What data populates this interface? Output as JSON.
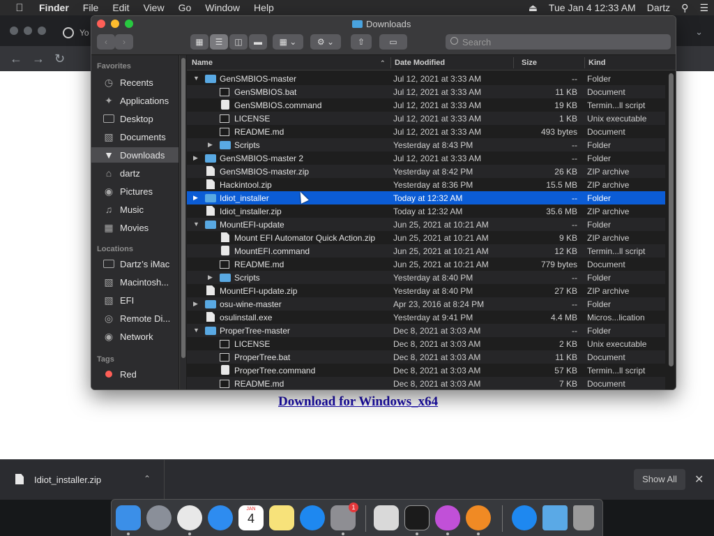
{
  "menubar": {
    "app": "Finder",
    "items": [
      "File",
      "Edit",
      "View",
      "Go",
      "Window",
      "Help"
    ],
    "datetime": "Tue Jan 4  12:33 AM",
    "user": "Dartz"
  },
  "chrome": {
    "tab_title": "Yo",
    "download_link": "Download for Windows_x64"
  },
  "download_shelf": {
    "file_name": "Idiot_installer.zip",
    "show_all": "Show All"
  },
  "finder": {
    "title": "Downloads",
    "search_placeholder": "Search",
    "sidebar": {
      "favorites_header": "Favorites",
      "favorites": [
        {
          "label": "Recents",
          "icon": "clock-icon"
        },
        {
          "label": "Applications",
          "icon": "applications-icon"
        },
        {
          "label": "Desktop",
          "icon": "desktop-icon"
        },
        {
          "label": "Documents",
          "icon": "documents-icon"
        },
        {
          "label": "Downloads",
          "icon": "downloads-icon",
          "selected": true
        },
        {
          "label": "dartz",
          "icon": "home-icon"
        },
        {
          "label": "Pictures",
          "icon": "camera-icon"
        },
        {
          "label": "Music",
          "icon": "music-icon"
        },
        {
          "label": "Movies",
          "icon": "film-icon"
        }
      ],
      "locations_header": "Locations",
      "locations": [
        {
          "label": "Dartz’s iMac",
          "icon": "imac-icon"
        },
        {
          "label": "Macintosh...",
          "icon": "disk-icon"
        },
        {
          "label": "EFI",
          "icon": "disk-icon"
        },
        {
          "label": "Remote Di...",
          "icon": "remote-disc-icon"
        },
        {
          "label": "Network",
          "icon": "network-icon"
        }
      ],
      "tags_header": "Tags",
      "tags": [
        {
          "label": "Red",
          "color": "#ff5f57"
        }
      ]
    },
    "columns": {
      "name": "Name",
      "date": "Date Modified",
      "size": "Size",
      "kind": "Kind"
    },
    "rows": [
      {
        "name": "GenSMBIOS-master",
        "date": "Jul 12, 2021 at 3:33 AM",
        "size": "--",
        "kind": "Folder",
        "level": 0,
        "disc": "open",
        "icon": "folder"
      },
      {
        "name": "GenSMBIOS.bat",
        "date": "Jul 12, 2021 at 3:33 AM",
        "size": "11 KB",
        "kind": "Document",
        "level": 1,
        "disc": "",
        "icon": "term"
      },
      {
        "name": "GenSMBIOS.command",
        "date": "Jul 12, 2021 at 3:33 AM",
        "size": "19 KB",
        "kind": "Termin...ll script",
        "level": 1,
        "disc": "",
        "icon": "script"
      },
      {
        "name": "LICENSE",
        "date": "Jul 12, 2021 at 3:33 AM",
        "size": "1 KB",
        "kind": "Unix executable",
        "level": 1,
        "disc": "",
        "icon": "term"
      },
      {
        "name": "README.md",
        "date": "Jul 12, 2021 at 3:33 AM",
        "size": "493 bytes",
        "kind": "Document",
        "level": 1,
        "disc": "",
        "icon": "term"
      },
      {
        "name": "Scripts",
        "date": "Yesterday at 8:43 PM",
        "size": "--",
        "kind": "Folder",
        "level": 1,
        "disc": "closed",
        "icon": "folder"
      },
      {
        "name": "GenSMBIOS-master 2",
        "date": "Jul 12, 2021 at 3:33 AM",
        "size": "--",
        "kind": "Folder",
        "level": 0,
        "disc": "closed",
        "icon": "folder"
      },
      {
        "name": "GenSMBIOS-master.zip",
        "date": "Yesterday at 8:42 PM",
        "size": "26 KB",
        "kind": "ZIP archive",
        "level": 0,
        "disc": "",
        "icon": "doc"
      },
      {
        "name": "Hackintool.zip",
        "date": "Yesterday at 8:36 PM",
        "size": "15.5 MB",
        "kind": "ZIP archive",
        "level": 0,
        "disc": "",
        "icon": "doc"
      },
      {
        "name": "Idiot_installer",
        "date": "Today at 12:32 AM",
        "size": "--",
        "kind": "Folder",
        "level": 0,
        "disc": "closed",
        "icon": "folder",
        "selected": true
      },
      {
        "name": "Idiot_installer.zip",
        "date": "Today at 12:32 AM",
        "size": "35.6 MB",
        "kind": "ZIP archive",
        "level": 0,
        "disc": "",
        "icon": "doc"
      },
      {
        "name": "MountEFI-update",
        "date": "Jun 25, 2021 at 10:21 AM",
        "size": "--",
        "kind": "Folder",
        "level": 0,
        "disc": "open",
        "icon": "folder"
      },
      {
        "name": "Mount EFI Automator Quick Action.zip",
        "date": "Jun 25, 2021 at 10:21 AM",
        "size": "9 KB",
        "kind": "ZIP archive",
        "level": 1,
        "disc": "",
        "icon": "doc"
      },
      {
        "name": "MountEFI.command",
        "date": "Jun 25, 2021 at 10:21 AM",
        "size": "12 KB",
        "kind": "Termin...ll script",
        "level": 1,
        "disc": "",
        "icon": "script"
      },
      {
        "name": "README.md",
        "date": "Jun 25, 2021 at 10:21 AM",
        "size": "779 bytes",
        "kind": "Document",
        "level": 1,
        "disc": "",
        "icon": "term"
      },
      {
        "name": "Scripts",
        "date": "Yesterday at 8:40 PM",
        "size": "--",
        "kind": "Folder",
        "level": 1,
        "disc": "closed",
        "icon": "folder"
      },
      {
        "name": "MountEFI-update.zip",
        "date": "Yesterday at 8:40 PM",
        "size": "27 KB",
        "kind": "ZIP archive",
        "level": 0,
        "disc": "",
        "icon": "doc"
      },
      {
        "name": "osu-wine-master",
        "date": "Apr 23, 2016 at 8:24 PM",
        "size": "--",
        "kind": "Folder",
        "level": 0,
        "disc": "closed",
        "icon": "folder"
      },
      {
        "name": "osulinstall.exe",
        "date": "Yesterday at 9:41 PM",
        "size": "4.4 MB",
        "kind": "Micros...lication",
        "level": 0,
        "disc": "",
        "icon": "doc"
      },
      {
        "name": "ProperTree-master",
        "date": "Dec 8, 2021 at 3:03 AM",
        "size": "--",
        "kind": "Folder",
        "level": 0,
        "disc": "open",
        "icon": "folder"
      },
      {
        "name": "LICENSE",
        "date": "Dec 8, 2021 at 3:03 AM",
        "size": "2 KB",
        "kind": "Unix executable",
        "level": 1,
        "disc": "",
        "icon": "term"
      },
      {
        "name": "ProperTree.bat",
        "date": "Dec 8, 2021 at 3:03 AM",
        "size": "11 KB",
        "kind": "Document",
        "level": 1,
        "disc": "",
        "icon": "term"
      },
      {
        "name": "ProperTree.command",
        "date": "Dec 8, 2021 at 3:03 AM",
        "size": "57 KB",
        "kind": "Termin...ll script",
        "level": 1,
        "disc": "",
        "icon": "script"
      },
      {
        "name": "README.md",
        "date": "Dec 8, 2021 at 3:03 AM",
        "size": "7 KB",
        "kind": "Document",
        "level": 1,
        "disc": "",
        "icon": "term"
      }
    ]
  },
  "dock": {
    "calendar_month": "JAN",
    "calendar_day": "4",
    "settings_badge": "1",
    "apps": [
      {
        "name": "finder-icon",
        "color": "#3b8fe8"
      },
      {
        "name": "launchpad-icon",
        "color": "#8a8f99"
      },
      {
        "name": "chrome-icon",
        "color": "#e8e8e8"
      },
      {
        "name": "safari-icon",
        "color": "#2e8cf0"
      },
      {
        "name": "calendar-icon",
        "color": "#ffffff"
      },
      {
        "name": "notes-icon",
        "color": "#f7e27a"
      },
      {
        "name": "app-store-icon",
        "color": "#1e88f0"
      },
      {
        "name": "system-preferences-icon",
        "color": "#8e8e93"
      },
      {
        "name": "preview-icon",
        "color": "#d9d9d9"
      },
      {
        "name": "terminal-icon",
        "color": "#1b1b1b"
      },
      {
        "name": "potion-app-icon",
        "color": "#c150d8"
      },
      {
        "name": "books-icon",
        "color": "#f08a24"
      },
      {
        "name": "app-store-2-icon",
        "color": "#1e88f0"
      },
      {
        "name": "downloads-folder-icon",
        "color": "#5aa9e6"
      },
      {
        "name": "trash-icon",
        "color": "#9a9a9a"
      }
    ]
  }
}
